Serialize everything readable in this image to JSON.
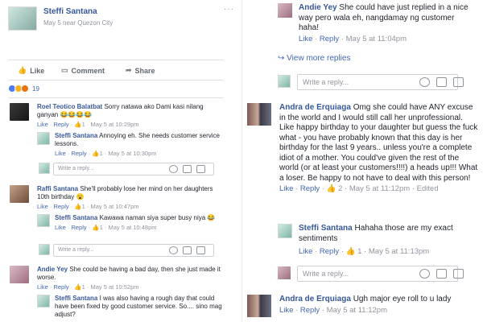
{
  "post": {
    "author": "Steffi Santana",
    "meta": "May 5 near Quezon City",
    "menu": "···",
    "actions": {
      "like": "Like",
      "comment": "Comment",
      "share": "Share"
    },
    "reaction_count": "19"
  },
  "left_comments": [
    {
      "author": "Roel Teotico Balatbat",
      "text": "Sorry natawa ako Dami kasi nilang ganyan 😂😂😂😂",
      "footer": {
        "like": "Like",
        "reply": "Reply",
        "likes": "1",
        "time": "May 5 at 10:29pm"
      },
      "reply": {
        "author": "Steffi Santana",
        "text": "Annoying eh. She needs customer service lessons.",
        "footer": {
          "like": "Like",
          "reply": "Reply",
          "likes": "1",
          "time": "May 5 at 10:30pm"
        }
      }
    },
    {
      "author": "Raffi Santana",
      "text": "She'll probably lose her mind on her daughters 10th birthday 😮",
      "footer": {
        "like": "Like",
        "reply": "Reply",
        "likes": "1",
        "time": "May 5 at 10:47pm"
      },
      "reply": {
        "author": "Steffi Santana",
        "text": "Kawawa naman siya super busy niya 😂",
        "footer": {
          "like": "Like",
          "reply": "Reply",
          "likes": "1",
          "time": "May 5 at 10:48pm"
        }
      }
    },
    {
      "author": "Andie Yey",
      "text": "She could be having a bad day, then she just made it worse.",
      "footer": {
        "like": "Like",
        "reply": "Reply",
        "likes": "1",
        "time": "May 5 at 10:52pm"
      },
      "reply": {
        "author": "Steffi Santana",
        "text": "I was also having a rough day that could have been fixed by good customer service. So.... sino mag adjust?"
      }
    }
  ],
  "reply_placeholder": "Write a reply...",
  "right": {
    "top_reply": {
      "author": "Andie Yey",
      "text": "She could have just replied in a nice way pero wala eh, nangdamay ng customer haha!",
      "footer": {
        "like": "Like",
        "reply": "Reply",
        "time": "May 5 at 11:04pm"
      }
    },
    "view_more": "View more replies",
    "comment1": {
      "author": "Andra de Erquiaga",
      "text": "Omg she could have ANY excuse in the world and I would still call her unprofessional. Like happy birthday to your daughter but guess the fuck what - you have probably known that this day is her birthday for the last 9 years.. unless you're a complete idiot of a mother. You could've given the rest of the world (or at least your customers!!!!) a heads up!!! What a loser. Be happy to not have to deal with this person!",
      "footer": {
        "like": "Like",
        "reply": "Reply",
        "likes": "2",
        "time": "May 5 at 11:12pm",
        "edited": "Edited"
      },
      "reply": {
        "author": "Steffi Santana",
        "text": "Hahaha those are my exact sentiments",
        "footer": {
          "like": "Like",
          "reply": "Reply",
          "likes": "1",
          "time": "May 5 at 11:13pm"
        }
      }
    },
    "comment2": {
      "author": "Andra de Erquiaga",
      "text": "Ugh major eye roll to u lady",
      "footer": {
        "like": "Like",
        "reply": "Reply",
        "time": "May 5 at 11:12pm"
      }
    }
  },
  "colors": {
    "link": "#4267b2",
    "name": "#365899",
    "meta": "#90949c",
    "like_blue": "#4b7cf0"
  }
}
